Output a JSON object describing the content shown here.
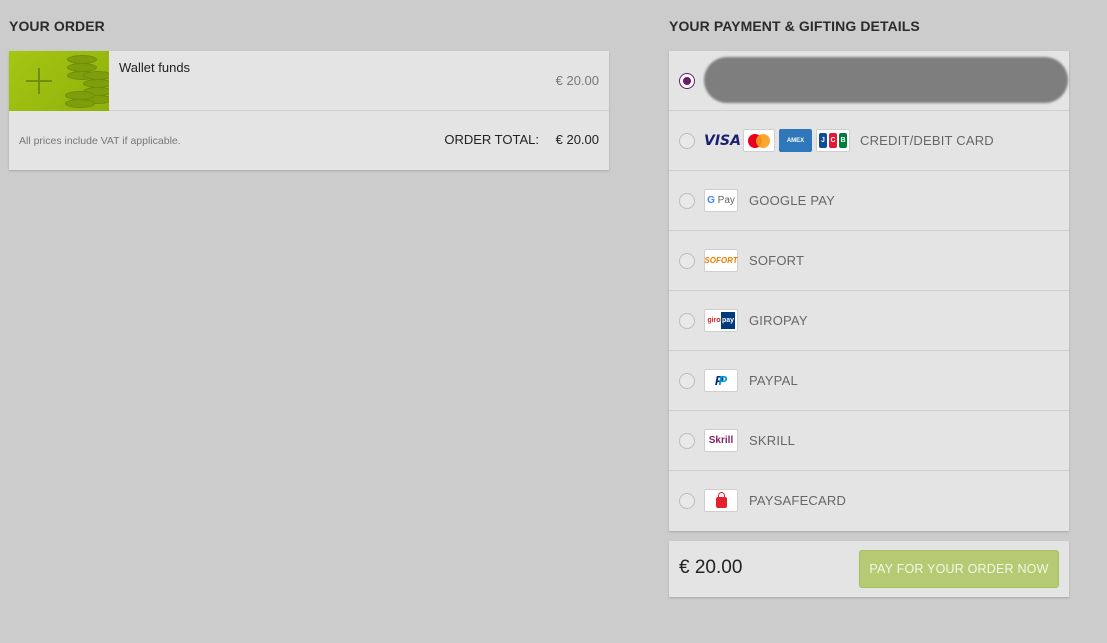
{
  "order": {
    "title": "YOUR ORDER",
    "item_name": "Wallet funds",
    "item_price": "€ 20.00",
    "vat_note": "All prices include VAT if applicable.",
    "total_label": "ORDER TOTAL:",
    "total_value": "€ 20.00"
  },
  "payment": {
    "title": "YOUR PAYMENT & GIFTING DETAILS",
    "methods": [
      {
        "id": "saved",
        "label": "",
        "selected": true
      },
      {
        "id": "card",
        "label": "CREDIT/DEBIT CARD",
        "logos": [
          "VISA",
          "MasterCard",
          "AMERICAN EXPRESS",
          "JCB"
        ],
        "selected": false
      },
      {
        "id": "googlepay",
        "label": "GOOGLE PAY",
        "logo": "G Pay",
        "selected": false
      },
      {
        "id": "sofort",
        "label": "SOFORT",
        "logo": "SOFORT",
        "selected": false
      },
      {
        "id": "giropay",
        "label": "GIROPAY",
        "logo_a": "giro",
        "logo_b": "pay",
        "selected": false
      },
      {
        "id": "paypal",
        "label": "PAYPAL",
        "logo": "P",
        "selected": false
      },
      {
        "id": "skrill",
        "label": "SKRILL",
        "logo": "Skrill",
        "selected": false
      },
      {
        "id": "paysafecard",
        "label": "PAYSAFECARD",
        "selected": false
      }
    ]
  },
  "pay_bar": {
    "total": "€ 20.00",
    "button_label": "PAY FOR YOUR ORDER NOW"
  },
  "colors": {
    "background": "#cccccc",
    "card": "#e4e4e4",
    "radio_selected": "#6a1b6a",
    "pay_button": "#b5ca72",
    "thumb_green": "#a6c613"
  }
}
